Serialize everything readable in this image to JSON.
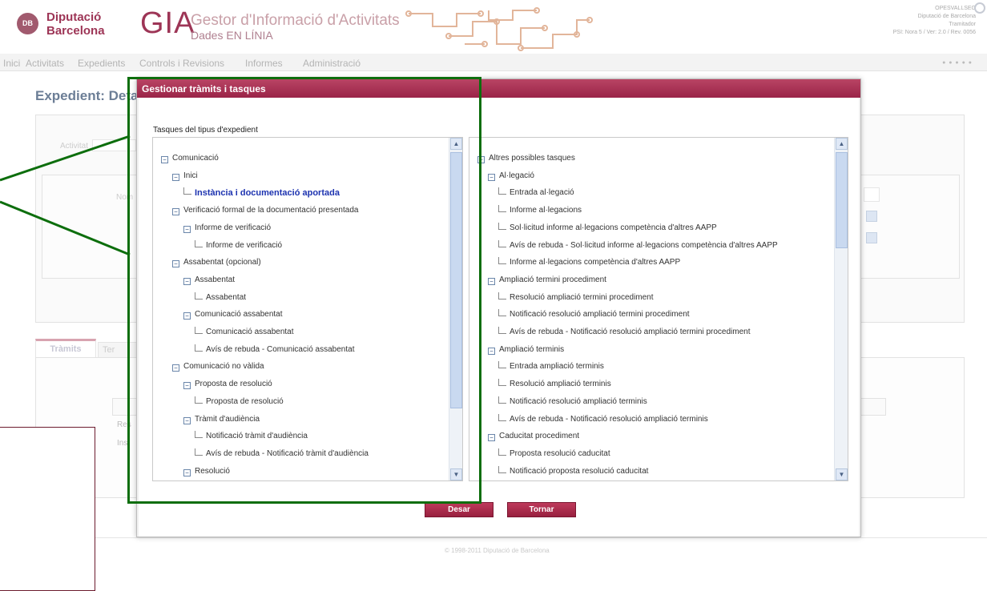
{
  "header": {
    "org_line1": "Diputació",
    "org_line2": "Barcelona",
    "app_acronym": "GIA",
    "app_title": "Gestor d'Informació d'Activitats",
    "app_subtitle": "Dades EN LÍNIA",
    "user_name": "OPESVALLSEG",
    "user_org": "Diputació de Barcelona",
    "user_role": "Tramitador",
    "version": "PSI: Nora 5 / Ver: 2.0 / Rev. 0056"
  },
  "nav": {
    "items": [
      "Inici",
      "Activitats",
      "Expedients",
      "Controls i Revisions",
      "Informes",
      "Administració"
    ],
    "dots": "● ● ● ● ●"
  },
  "background": {
    "page_title": "Expedient: Deta",
    "activitat_label": "Activitat",
    "nom_label": "Nom",
    "tab_tramits": "Tràmits",
    "tab_other": "Ter",
    "row1": "Res",
    "row2": "Inst",
    "footer": "© 1998-2011 Diputació de Barcelona"
  },
  "modal": {
    "title": "Gestionar tràmits i tasques",
    "section_label": "Tasques del tipus d'expedient",
    "left_tree": [
      {
        "text": "Comunicació",
        "kind": "node"
      },
      {
        "text": "Inici",
        "kind": "node"
      },
      {
        "text": "Instància i documentació aportada",
        "kind": "leaf",
        "active": true
      },
      {
        "text": "Verificació formal de la documentació presentada",
        "kind": "node"
      },
      {
        "text": "Informe de verificació",
        "kind": "node"
      },
      {
        "text": "Informe de verificació",
        "kind": "leaf"
      },
      {
        "text": "Assabentat (opcional)",
        "kind": "node"
      },
      {
        "text": "Assabentat",
        "kind": "node"
      },
      {
        "text": "Assabentat",
        "kind": "leaf"
      },
      {
        "text": "Comunicació assabentat",
        "kind": "node"
      },
      {
        "text": "Comunicació assabentat",
        "kind": "leaf"
      },
      {
        "text": "Avís de rebuda - Comunicació assabentat",
        "kind": "leaf"
      },
      {
        "text": "Comunicació no vàlida",
        "kind": "node"
      },
      {
        "text": "Proposta de resolució",
        "kind": "node"
      },
      {
        "text": "Proposta de resolució",
        "kind": "leaf"
      },
      {
        "text": "Tràmit d'audiència",
        "kind": "node"
      },
      {
        "text": "Notificació tràmit d'audiència",
        "kind": "leaf"
      },
      {
        "text": "Avís de rebuda - Notificació tràmit d'audiència",
        "kind": "leaf"
      },
      {
        "text": "Resolució",
        "kind": "node"
      }
    ],
    "right_tree": [
      {
        "text": "Altres possibles tasques",
        "kind": "node"
      },
      {
        "text": "Al·legació",
        "kind": "node"
      },
      {
        "text": "Entrada al·legació",
        "kind": "leaf"
      },
      {
        "text": "Informe al·legacions",
        "kind": "leaf"
      },
      {
        "text": "Sol·licitud informe al·legacions competència d'altres AAPP",
        "kind": "leaf"
      },
      {
        "text": "Avís de rebuda - Sol·licitud informe al·legacions competència d'altres AAPP",
        "kind": "leaf"
      },
      {
        "text": "Informe al·legacions competència d'altres AAPP",
        "kind": "leaf"
      },
      {
        "text": "Ampliació termini procediment",
        "kind": "node"
      },
      {
        "text": "Resolució ampliació termini procediment",
        "kind": "leaf"
      },
      {
        "text": "Notificació resolució ampliació termini procediment",
        "kind": "leaf"
      },
      {
        "text": "Avís de rebuda - Notificació resolució ampliació termini procediment",
        "kind": "leaf"
      },
      {
        "text": "Ampliació terminis",
        "kind": "node"
      },
      {
        "text": "Entrada ampliació terminis",
        "kind": "leaf"
      },
      {
        "text": "Resolució ampliació terminis",
        "kind": "leaf"
      },
      {
        "text": "Notificació resolució ampliació terminis",
        "kind": "leaf"
      },
      {
        "text": "Avís de rebuda - Notificació resolució ampliació terminis",
        "kind": "leaf"
      },
      {
        "text": "Caducitat procediment",
        "kind": "node"
      },
      {
        "text": "Proposta resolució caducitat",
        "kind": "leaf"
      },
      {
        "text": "Notificació proposta resolució caducitat",
        "kind": "leaf"
      }
    ],
    "save_label": "Desar",
    "back_label": "Tornar"
  },
  "colors": {
    "brand": "#9d3556",
    "highlight": "#0d6e0d",
    "active_link": "#1d33b0"
  }
}
